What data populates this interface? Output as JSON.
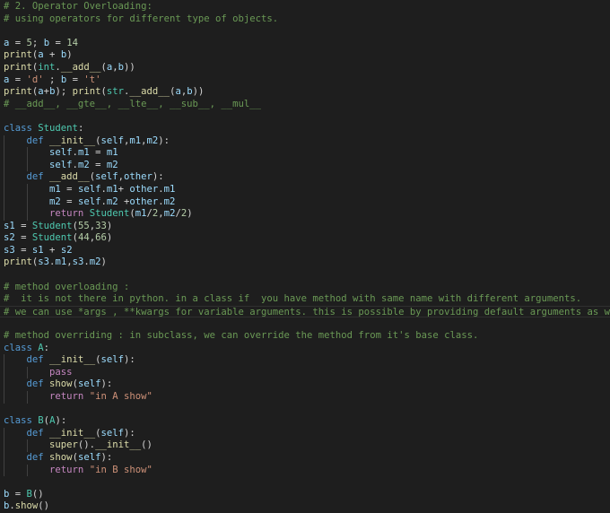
{
  "editor": {
    "theme_colors": {
      "background": "#1e1e1e",
      "comment": "#6a9955",
      "keyword": "#569cd6",
      "control": "#c586c0",
      "class": "#4ec9b0",
      "function": "#dcdcaa",
      "variable": "#9cdcfe",
      "number": "#b5cea8",
      "string": "#ce9178",
      "plain": "#d4d4d4"
    },
    "lines": [
      {
        "indent": 0,
        "tokens": [
          [
            "comment",
            "# 2. Operator Overloading:"
          ]
        ]
      },
      {
        "indent": 0,
        "tokens": [
          [
            "comment",
            "# using operators for different type of objects."
          ]
        ]
      },
      {
        "indent": 0,
        "tokens": []
      },
      {
        "indent": 0,
        "tokens": [
          [
            "var",
            "a"
          ],
          [
            "plain",
            " = "
          ],
          [
            "number",
            "5"
          ],
          [
            "plain",
            "; "
          ],
          [
            "var",
            "b"
          ],
          [
            "plain",
            " = "
          ],
          [
            "number",
            "14"
          ]
        ]
      },
      {
        "indent": 0,
        "tokens": [
          [
            "func",
            "print"
          ],
          [
            "plain",
            "("
          ],
          [
            "var",
            "a"
          ],
          [
            "plain",
            " + "
          ],
          [
            "var",
            "b"
          ],
          [
            "plain",
            ")"
          ]
        ]
      },
      {
        "indent": 0,
        "tokens": [
          [
            "func",
            "print"
          ],
          [
            "plain",
            "("
          ],
          [
            "class",
            "int"
          ],
          [
            "plain",
            "."
          ],
          [
            "func",
            "__add__"
          ],
          [
            "plain",
            "("
          ],
          [
            "var",
            "a"
          ],
          [
            "plain",
            ","
          ],
          [
            "var",
            "b"
          ],
          [
            "plain",
            "))"
          ]
        ]
      },
      {
        "indent": 0,
        "tokens": [
          [
            "var",
            "a"
          ],
          [
            "plain",
            " = "
          ],
          [
            "string",
            "'d'"
          ],
          [
            "plain",
            " ; "
          ],
          [
            "var",
            "b"
          ],
          [
            "plain",
            " = "
          ],
          [
            "string",
            "'t'"
          ]
        ]
      },
      {
        "indent": 0,
        "tokens": [
          [
            "func",
            "print"
          ],
          [
            "plain",
            "("
          ],
          [
            "var",
            "a"
          ],
          [
            "plain",
            "+"
          ],
          [
            "var",
            "b"
          ],
          [
            "plain",
            "); "
          ],
          [
            "func",
            "print"
          ],
          [
            "plain",
            "("
          ],
          [
            "class",
            "str"
          ],
          [
            "plain",
            "."
          ],
          [
            "func",
            "__add__"
          ],
          [
            "plain",
            "("
          ],
          [
            "var",
            "a"
          ],
          [
            "plain",
            ","
          ],
          [
            "var",
            "b"
          ],
          [
            "plain",
            "))"
          ]
        ]
      },
      {
        "indent": 0,
        "tokens": [
          [
            "comment",
            "# __add__, __gte__, __lte__, __sub__, __mul__"
          ]
        ]
      },
      {
        "indent": 0,
        "tokens": []
      },
      {
        "indent": 0,
        "tokens": [
          [
            "keyword",
            "class"
          ],
          [
            "plain",
            " "
          ],
          [
            "class",
            "Student"
          ],
          [
            "plain",
            ":"
          ]
        ]
      },
      {
        "indent": 1,
        "tokens": [
          [
            "keyword",
            "def"
          ],
          [
            "plain",
            " "
          ],
          [
            "func",
            "__init__"
          ],
          [
            "plain",
            "("
          ],
          [
            "var",
            "self"
          ],
          [
            "plain",
            ","
          ],
          [
            "var",
            "m1"
          ],
          [
            "plain",
            ","
          ],
          [
            "var",
            "m2"
          ],
          [
            "plain",
            "):"
          ]
        ]
      },
      {
        "indent": 2,
        "tokens": [
          [
            "var",
            "self"
          ],
          [
            "plain",
            "."
          ],
          [
            "var",
            "m1"
          ],
          [
            "plain",
            " = "
          ],
          [
            "var",
            "m1"
          ]
        ]
      },
      {
        "indent": 2,
        "tokens": [
          [
            "var",
            "self"
          ],
          [
            "plain",
            "."
          ],
          [
            "var",
            "m2"
          ],
          [
            "plain",
            " = "
          ],
          [
            "var",
            "m2"
          ]
        ]
      },
      {
        "indent": 1,
        "tokens": [
          [
            "keyword",
            "def"
          ],
          [
            "plain",
            " "
          ],
          [
            "func",
            "__add__"
          ],
          [
            "plain",
            "("
          ],
          [
            "var",
            "self"
          ],
          [
            "plain",
            ","
          ],
          [
            "var",
            "other"
          ],
          [
            "plain",
            "):"
          ]
        ]
      },
      {
        "indent": 2,
        "tokens": [
          [
            "var",
            "m1"
          ],
          [
            "plain",
            " = "
          ],
          [
            "var",
            "self"
          ],
          [
            "plain",
            "."
          ],
          [
            "var",
            "m1"
          ],
          [
            "plain",
            "+ "
          ],
          [
            "var",
            "other"
          ],
          [
            "plain",
            "."
          ],
          [
            "var",
            "m1"
          ]
        ]
      },
      {
        "indent": 2,
        "tokens": [
          [
            "var",
            "m2"
          ],
          [
            "plain",
            " = "
          ],
          [
            "var",
            "self"
          ],
          [
            "plain",
            "."
          ],
          [
            "var",
            "m2"
          ],
          [
            "plain",
            " +"
          ],
          [
            "var",
            "other"
          ],
          [
            "plain",
            "."
          ],
          [
            "var",
            "m2"
          ]
        ]
      },
      {
        "indent": 2,
        "tokens": [
          [
            "control",
            "return"
          ],
          [
            "plain",
            " "
          ],
          [
            "class",
            "Student"
          ],
          [
            "plain",
            "("
          ],
          [
            "var",
            "m1"
          ],
          [
            "plain",
            "/"
          ],
          [
            "number",
            "2"
          ],
          [
            "plain",
            ","
          ],
          [
            "var",
            "m2"
          ],
          [
            "plain",
            "/"
          ],
          [
            "number",
            "2"
          ],
          [
            "plain",
            ")"
          ]
        ]
      },
      {
        "indent": 0,
        "tokens": [
          [
            "var",
            "s1"
          ],
          [
            "plain",
            " = "
          ],
          [
            "class",
            "Student"
          ],
          [
            "plain",
            "("
          ],
          [
            "number",
            "55"
          ],
          [
            "plain",
            ","
          ],
          [
            "number",
            "33"
          ],
          [
            "plain",
            ")"
          ]
        ]
      },
      {
        "indent": 0,
        "tokens": [
          [
            "var",
            "s2"
          ],
          [
            "plain",
            " = "
          ],
          [
            "class",
            "Student"
          ],
          [
            "plain",
            "("
          ],
          [
            "number",
            "44"
          ],
          [
            "plain",
            ","
          ],
          [
            "number",
            "66"
          ],
          [
            "plain",
            ")"
          ]
        ]
      },
      {
        "indent": 0,
        "tokens": [
          [
            "var",
            "s3"
          ],
          [
            "plain",
            " = "
          ],
          [
            "var",
            "s1"
          ],
          [
            "plain",
            " + "
          ],
          [
            "var",
            "s2"
          ]
        ]
      },
      {
        "indent": 0,
        "tokens": [
          [
            "func",
            "print"
          ],
          [
            "plain",
            "("
          ],
          [
            "var",
            "s3"
          ],
          [
            "plain",
            "."
          ],
          [
            "var",
            "m1"
          ],
          [
            "plain",
            ","
          ],
          [
            "var",
            "s3"
          ],
          [
            "plain",
            "."
          ],
          [
            "var",
            "m2"
          ],
          [
            "plain",
            ")"
          ]
        ]
      },
      {
        "indent": 0,
        "tokens": []
      },
      {
        "indent": 0,
        "tokens": [
          [
            "comment",
            "# method overloading :"
          ]
        ]
      },
      {
        "indent": 0,
        "tokens": [
          [
            "comment",
            "#  it is not there in python. in a class if  you have method with same name with different arguments."
          ]
        ]
      },
      {
        "indent": 0,
        "current": true,
        "tokens": [
          [
            "comment",
            "# we can use *args , **kwargs for variable arguments. this is possible by providing default arguments as well."
          ]
        ]
      },
      {
        "indent": 0,
        "tokens": []
      },
      {
        "indent": 0,
        "tokens": [
          [
            "comment",
            "# method overriding : in subclass, we can override the method from it's base class."
          ]
        ]
      },
      {
        "indent": 0,
        "tokens": [
          [
            "keyword",
            "class"
          ],
          [
            "plain",
            " "
          ],
          [
            "class",
            "A"
          ],
          [
            "plain",
            ":"
          ]
        ]
      },
      {
        "indent": 1,
        "tokens": [
          [
            "keyword",
            "def"
          ],
          [
            "plain",
            " "
          ],
          [
            "func",
            "__init__"
          ],
          [
            "plain",
            "("
          ],
          [
            "var",
            "self"
          ],
          [
            "plain",
            "):"
          ]
        ]
      },
      {
        "indent": 2,
        "tokens": [
          [
            "control",
            "pass"
          ]
        ]
      },
      {
        "indent": 1,
        "tokens": [
          [
            "keyword",
            "def"
          ],
          [
            "plain",
            " "
          ],
          [
            "func",
            "show"
          ],
          [
            "plain",
            "("
          ],
          [
            "var",
            "self"
          ],
          [
            "plain",
            "):"
          ]
        ]
      },
      {
        "indent": 2,
        "tokens": [
          [
            "control",
            "return"
          ],
          [
            "plain",
            " "
          ],
          [
            "string",
            "\"in A show\""
          ]
        ]
      },
      {
        "indent": 0,
        "tokens": []
      },
      {
        "indent": 0,
        "tokens": [
          [
            "keyword",
            "class"
          ],
          [
            "plain",
            " "
          ],
          [
            "class",
            "B"
          ],
          [
            "plain",
            "("
          ],
          [
            "class",
            "A"
          ],
          [
            "plain",
            "):"
          ]
        ]
      },
      {
        "indent": 1,
        "tokens": [
          [
            "keyword",
            "def"
          ],
          [
            "plain",
            " "
          ],
          [
            "func",
            "__init__"
          ],
          [
            "plain",
            "("
          ],
          [
            "var",
            "self"
          ],
          [
            "plain",
            "):"
          ]
        ]
      },
      {
        "indent": 2,
        "tokens": [
          [
            "func",
            "super"
          ],
          [
            "plain",
            "()."
          ],
          [
            "func",
            "__init__"
          ],
          [
            "plain",
            "()"
          ]
        ]
      },
      {
        "indent": 1,
        "tokens": [
          [
            "keyword",
            "def"
          ],
          [
            "plain",
            " "
          ],
          [
            "func",
            "show"
          ],
          [
            "plain",
            "("
          ],
          [
            "var",
            "self"
          ],
          [
            "plain",
            "):"
          ]
        ]
      },
      {
        "indent": 2,
        "tokens": [
          [
            "control",
            "return"
          ],
          [
            "plain",
            " "
          ],
          [
            "string",
            "\"in B show\""
          ]
        ]
      },
      {
        "indent": 0,
        "tokens": []
      },
      {
        "indent": 0,
        "tokens": [
          [
            "var",
            "b"
          ],
          [
            "plain",
            " = "
          ],
          [
            "class",
            "B"
          ],
          [
            "plain",
            "()"
          ]
        ]
      },
      {
        "indent": 0,
        "tokens": [
          [
            "var",
            "b"
          ],
          [
            "plain",
            "."
          ],
          [
            "func",
            "show"
          ],
          [
            "plain",
            "()"
          ]
        ]
      }
    ]
  }
}
